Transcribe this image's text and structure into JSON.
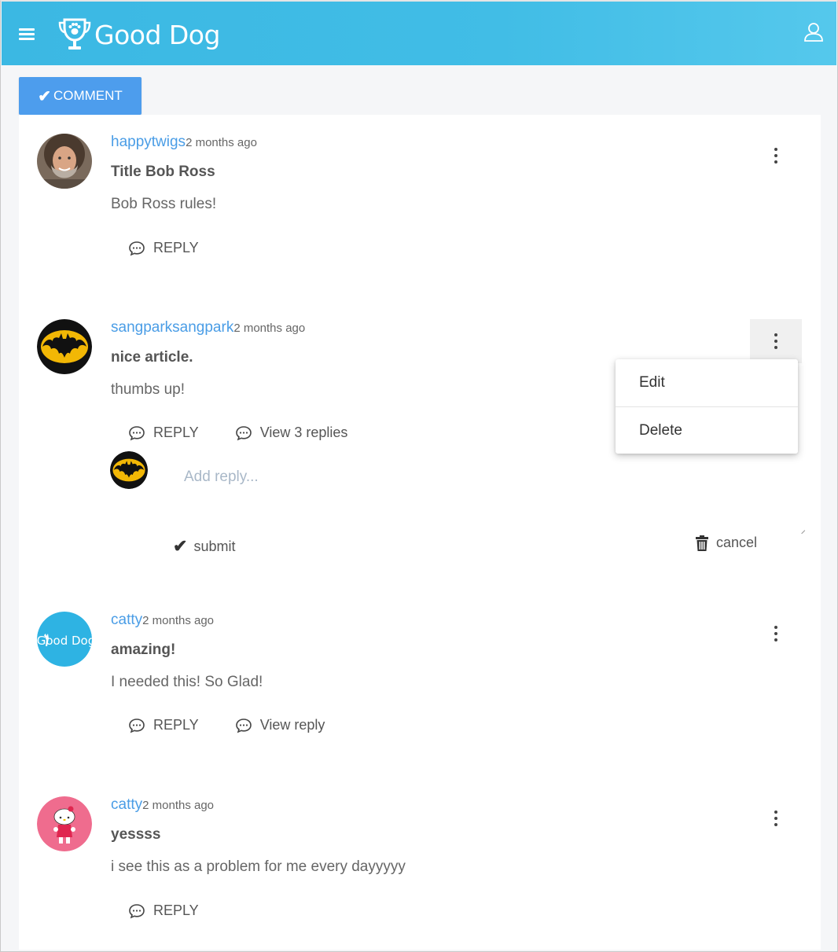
{
  "header": {
    "brand": "Good Dog",
    "menu_icon": "hamburger-menu-icon",
    "user_icon": "user-profile-icon",
    "color": "#3bb8e3"
  },
  "toolbar": {
    "comment_label": "COMMENT",
    "comment_color": "#4d9ded"
  },
  "comments": [
    {
      "username": "happytwigs",
      "time": "2 months ago",
      "title": "Title Bob Ross",
      "body": "Bob Ross rules!",
      "reply_label": "REPLY"
    },
    {
      "username": "sangparksangpark",
      "time": "2 months ago",
      "title": "nice article.",
      "body": "thumbs up!",
      "reply_label": "REPLY",
      "view_replies_label": "View 3 replies"
    },
    {
      "username": "catty",
      "time": "2 months ago",
      "title": "amazing!",
      "body": "I needed this! So Glad!",
      "reply_label": "REPLY",
      "view_replies_label": "View reply",
      "avatar_text": "Good Dog"
    },
    {
      "username": "catty",
      "time": "2 months ago",
      "title": "yessss",
      "body": "i see this as a problem for me every dayyyyy",
      "reply_label": "REPLY"
    }
  ],
  "reply_form": {
    "placeholder": "Add reply...",
    "submit_label": "submit",
    "cancel_label": "cancel"
  },
  "dropdown": {
    "items": [
      "Edit",
      "Delete"
    ]
  }
}
